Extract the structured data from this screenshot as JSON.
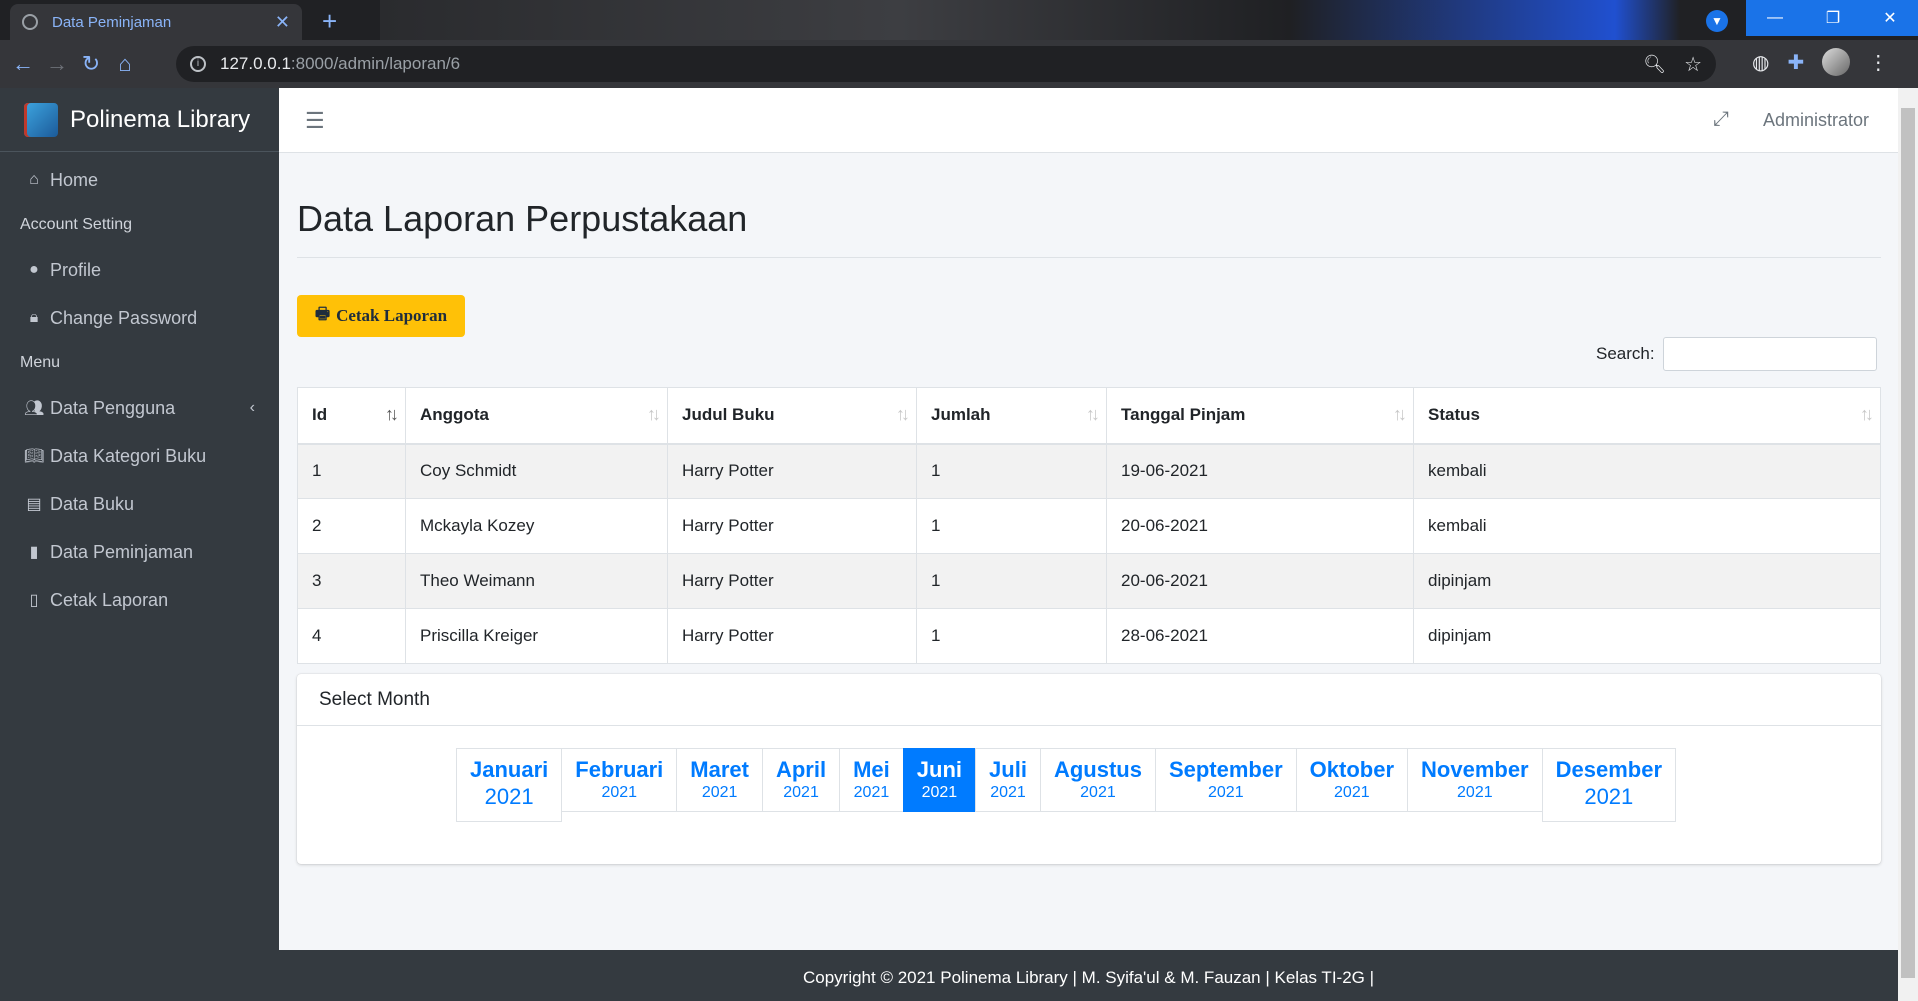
{
  "browser": {
    "tab_title": "Data Peminjaman",
    "url_host": "127.0.0.1",
    "url_path": ":8000/admin/laporan/6"
  },
  "sidebar": {
    "brand": "Polinema Library",
    "home": "Home",
    "account_header": "Account Setting",
    "profile": "Profile",
    "change_password": "Change Password",
    "menu_header": "Menu",
    "items": [
      {
        "label": "Data Pengguna",
        "icon": "users-icon"
      },
      {
        "label": "Data Kategori Buku",
        "icon": "book-open-icon"
      },
      {
        "label": "Data Buku",
        "icon": "book-icon"
      },
      {
        "label": "Data Peminjaman",
        "icon": "file-icon"
      },
      {
        "label": "Cetak Laporan",
        "icon": "pdf-file-icon"
      }
    ]
  },
  "topbar": {
    "user": "Administrator"
  },
  "page": {
    "title": "Data Laporan Perpustakaan",
    "print_button": "Cetak Laporan",
    "search_label": "Search:"
  },
  "table": {
    "headers": [
      "Id",
      "Anggota",
      "Judul Buku",
      "Jumlah",
      "Tanggal Pinjam",
      "Status"
    ],
    "rows": [
      [
        "1",
        "Coy Schmidt",
        "Harry Potter",
        "1",
        "19-06-2021",
        "kembali"
      ],
      [
        "2",
        "Mckayla Kozey",
        "Harry Potter",
        "1",
        "20-06-2021",
        "kembali"
      ],
      [
        "3",
        "Theo Weimann",
        "Harry Potter",
        "1",
        "20-06-2021",
        "dipinjam"
      ],
      [
        "4",
        "Priscilla Kreiger",
        "Harry Potter",
        "1",
        "28-06-2021",
        "dipinjam"
      ]
    ]
  },
  "month_card": {
    "title": "Select Month",
    "year": "2021",
    "months": [
      "Januari",
      "Februari",
      "Maret",
      "April",
      "Mei",
      "Juni",
      "Juli",
      "Agustus",
      "September",
      "Oktober",
      "November",
      "Desember"
    ],
    "active": "Juni"
  },
  "footer": {
    "text": "Copyright © 2021 Polinema Library | M. Syifa'ul & M. Fauzan | Kelas TI-2G |"
  }
}
